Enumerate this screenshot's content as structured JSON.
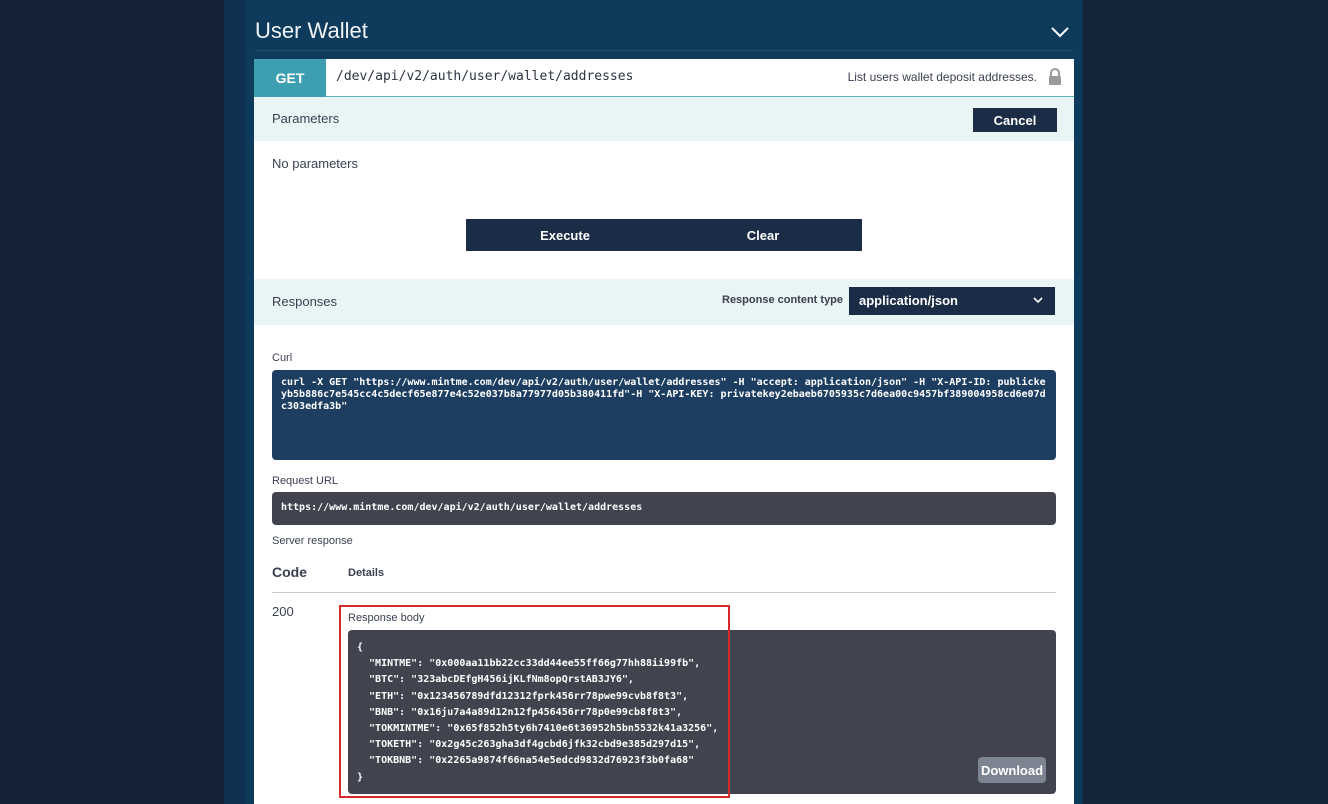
{
  "section": {
    "title": "User Wallet"
  },
  "operation": {
    "method": "GET",
    "path": "/dev/api/v2/auth/user/wallet/addresses",
    "summary": "List users wallet deposit addresses."
  },
  "parameters": {
    "heading": "Parameters",
    "cancel_label": "Cancel",
    "empty_text": "No parameters",
    "execute_label": "Execute",
    "clear_label": "Clear"
  },
  "responses": {
    "heading": "Responses",
    "content_type_label": "Response content type",
    "content_type_value": "application/json"
  },
  "curl": {
    "label": "Curl",
    "command": "curl -X GET \"https://www.mintme.com/dev/api/v2/auth/user/wallet/addresses\" -H \"accept: application/json\" -H \"X-API-ID: publickeyb5b886c7e545cc4c5decf65e877e4c52e037b8a77977d05b380411fd\"-H \"X-API-KEY: privatekey2ebaeb6705935c7d6ea00c9457bf389004958cd6e07dc303edfa3b\""
  },
  "request_url": {
    "label": "Request URL",
    "value": "https://www.mintme.com/dev/api/v2/auth/user/wallet/addresses"
  },
  "server_response": {
    "label": "Server response",
    "code_header": "Code",
    "details_header": "Details",
    "status_code": "200",
    "body_label": "Response body",
    "body_lines": [
      "{",
      "  \"MINTME\": \"0x000aa11bb22cc33dd44ee55ff66g77hh88ii99fb\",",
      "  \"BTC\": \"323abcDEfgH456ijKLfNm8opQrstAB3JY6\",",
      "  \"ETH\": \"0x123456789dfd12312fprk456rr78pwe99cvb8f8t3\",",
      "  \"BNB\": \"0x16ju7a4a89d12n12fp456456rr78p0e99cb8f8t3\",",
      "  \"TOKMINTME\": \"0x65f852h5ty6h7410e6t36952h5bn5532k41a3256\",",
      "  \"TOKETH\": \"0x2g45c263gha3df4gcbd6jfk32cbd9e385d297d15\",",
      "  \"TOKBNB\": \"0x2265a9874f66na54e5edcd9832d76923f3b0fa68\"",
      "}"
    ],
    "download_label": "Download"
  },
  "colors": {
    "get_method": "#3e9fb0",
    "button_dark": "#1b2d46",
    "highlight": "#d42a2a"
  },
  "icons": [
    "chevron-down-icon",
    "lock-icon",
    "select-chevron-icon"
  ]
}
